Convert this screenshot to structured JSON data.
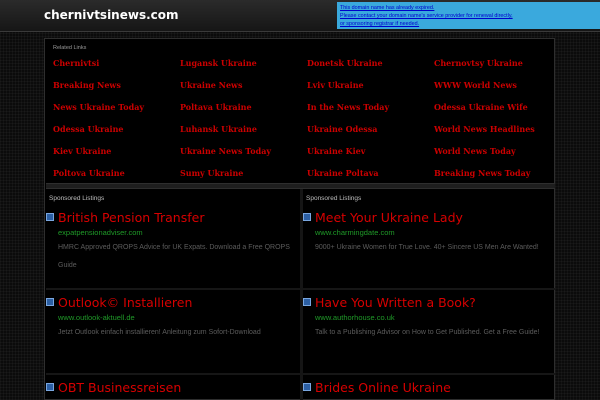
{
  "header": {
    "site_title": "chernivtsinews.com",
    "notice_lines": [
      "This domain name has already expired.",
      "Please contact your domain name's service provider for renewal directly,",
      "or sponsoring registrar if needed."
    ]
  },
  "related": {
    "header": "Related Links",
    "links": [
      "Chernivtsi",
      "Lugansk Ukraine",
      "Donetsk Ukraine",
      "Chernovtsy Ukraine",
      "Breaking News",
      "Ukraine News",
      "Lviv Ukraine",
      "WWW World News",
      "News Ukraine Today",
      "Poltava Ukraine",
      "In the News Today",
      "Odessa Ukraine Wife",
      "Odessa Ukraine",
      "Luhansk Ukraine",
      "Ukraine Odessa",
      "World News Headlines",
      "Kiev Ukraine",
      "Ukraine News Today",
      "Ukraine Kiev",
      "World News Today",
      "Poltova Ukraine",
      "Sumy Ukraine",
      "Ukraine Poltava",
      "Breaking News Today"
    ]
  },
  "sponsored": {
    "left_header": "Sponsored Listings",
    "right_header": "Sponsored Listings",
    "left": [
      {
        "title": "British Pension Transfer",
        "url": "expatpensionadviser.com",
        "desc": "HMRC Approved QROPS Advice for UK Expats. Download a Free QROPS Guide"
      },
      {
        "title": "Outlook© Installieren",
        "url": "www.outlook-aktuell.de",
        "desc": "Jetzt Outlook einfach installieren! Anleitung zum Sofort-Download"
      },
      {
        "title": "OBT Businessreisen",
        "url": "",
        "desc": ""
      }
    ],
    "right": [
      {
        "title": "Meet Your Ukraine Lady",
        "url": "www.charmingdate.com",
        "desc": "9000+ Ukraine Women for True Love. 40+ Sincere US Men Are Wanted!"
      },
      {
        "title": "Have You Written a Book?",
        "url": "www.authorhouse.co.uk",
        "desc": "Talk to a Publishing Advisor on How to Get Published. Get a Free Guide!"
      },
      {
        "title": "Brides Online Ukraine",
        "url": "",
        "desc": ""
      }
    ]
  },
  "colors": {
    "link_red": "#cc0000",
    "url_green": "#1f9a28",
    "notice_bg": "#3aa9dd",
    "bullet_blue": "#2c5fa3"
  }
}
